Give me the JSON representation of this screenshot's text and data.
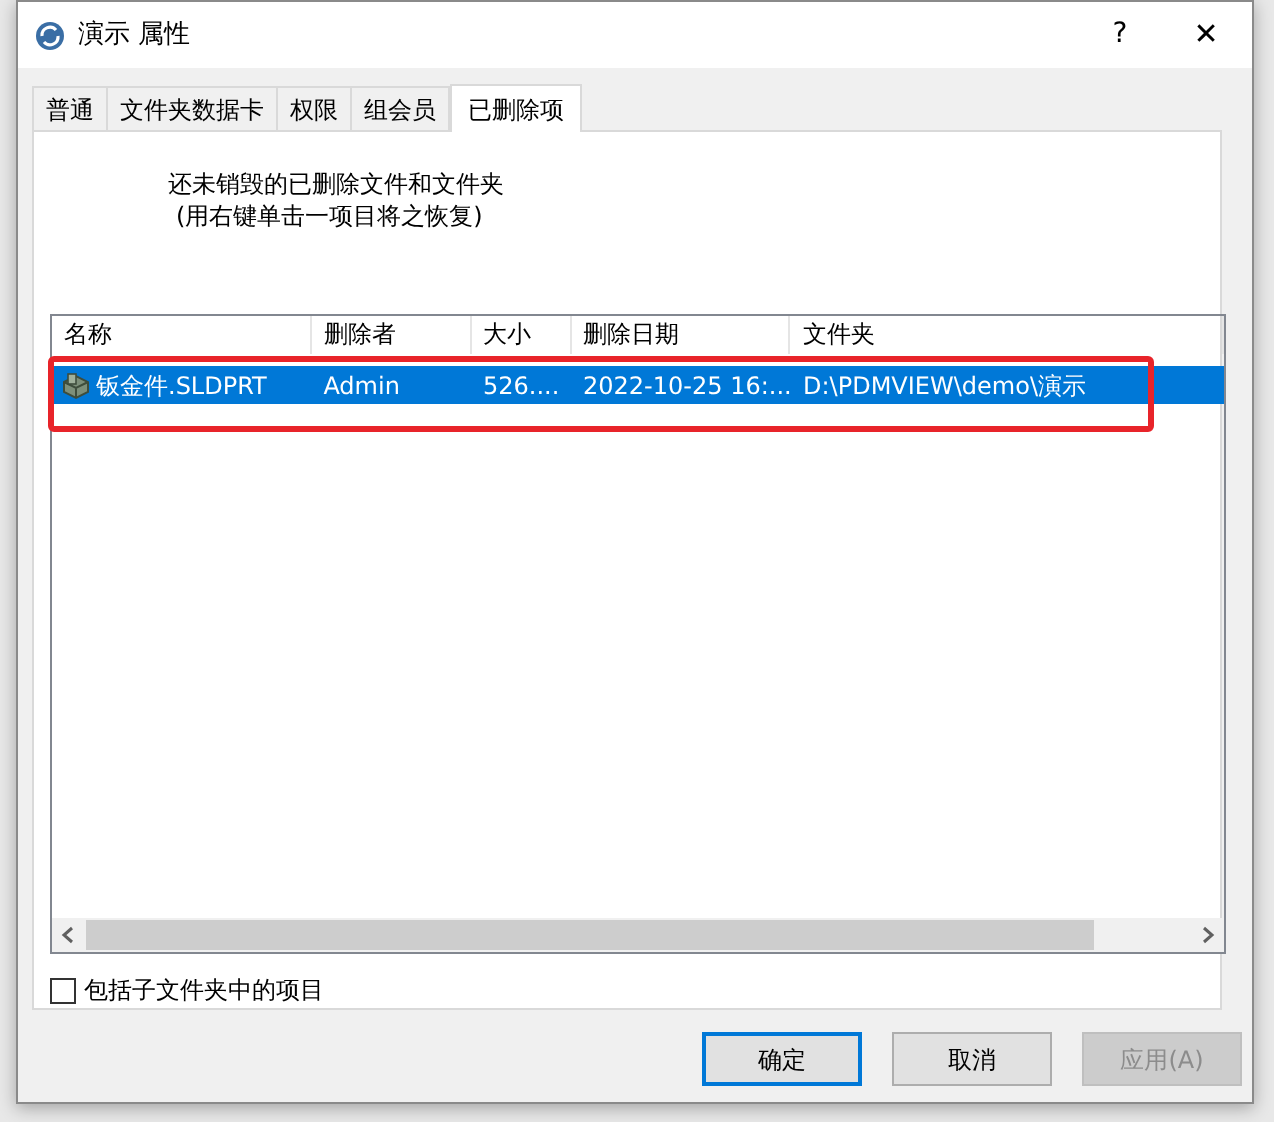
{
  "window": {
    "title": "演示 属性",
    "help": "?",
    "close": "✕"
  },
  "tabs": [
    {
      "label": "普通",
      "selected": false
    },
    {
      "label": "文件夹数据卡",
      "selected": false
    },
    {
      "label": "权限",
      "selected": false
    },
    {
      "label": "组会员",
      "selected": false
    },
    {
      "label": "已删除项",
      "selected": true
    }
  ],
  "description": [
    "还未销毁的已删除文件和文件夹",
    "(用右键单击一项目将之恢复)"
  ],
  "table": {
    "columns": [
      "名称",
      "删除者",
      "大小",
      "删除日期",
      "文件夹"
    ],
    "rows": [
      {
        "cells": [
          "钣金件.SLDPRT",
          "Admin",
          "526....",
          "2022-10-25 16:...",
          "D:\\PDMVIEW\\demo\\演示"
        ],
        "selected": true
      }
    ]
  },
  "annotation": {
    "kind": "rectangle",
    "color": "#e8242a"
  },
  "include_subfolders": {
    "label": "包括子文件夹中的项目",
    "checked": false
  },
  "buttons": [
    {
      "label": "确定",
      "default": true,
      "disabled": false
    },
    {
      "label": "取消",
      "default": false,
      "disabled": false
    },
    {
      "label": "应用(A)",
      "default": false,
      "disabled": true
    }
  ]
}
